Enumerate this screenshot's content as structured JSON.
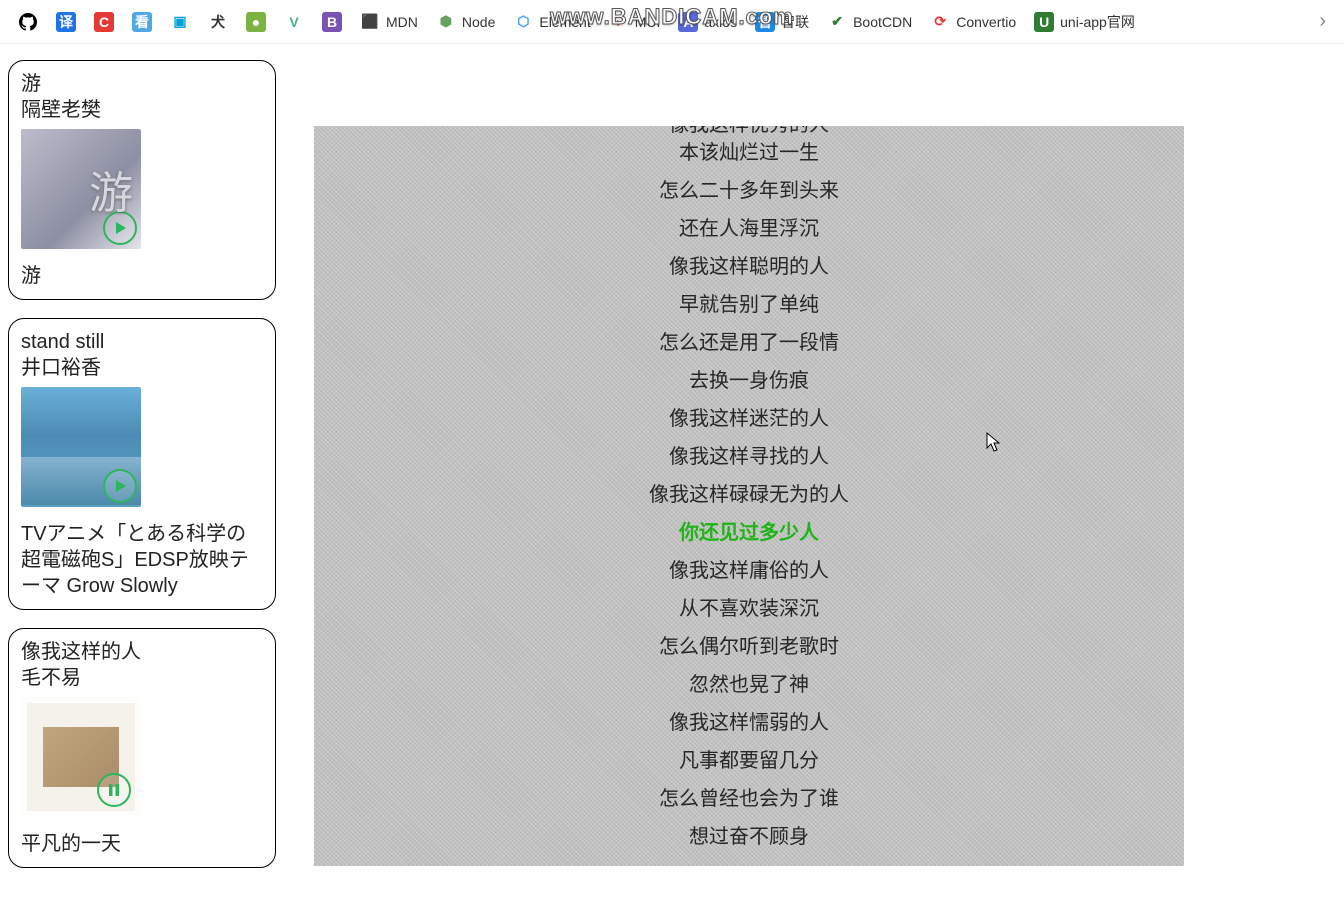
{
  "watermark": "www.BANDICAM.com",
  "bookmarks": [
    {
      "label": "",
      "icon_bg": "#ffffff",
      "icon_fg": "#000000",
      "glyph": "gh"
    },
    {
      "label": "",
      "icon_bg": "#1e73e8",
      "icon_fg": "#ffffff",
      "glyph": "译"
    },
    {
      "label": "",
      "icon_bg": "#e53935",
      "icon_fg": "#ffffff",
      "glyph": "C"
    },
    {
      "label": "",
      "icon_bg": "#4fa8e6",
      "icon_fg": "#ffffff",
      "glyph": "看"
    },
    {
      "label": "",
      "icon_bg": "#ffffff",
      "icon_fg": "#00a1d6",
      "glyph": "▣"
    },
    {
      "label": "",
      "icon_bg": "#ffffff",
      "icon_fg": "#333333",
      "glyph": "犬"
    },
    {
      "label": "",
      "icon_bg": "#7cb342",
      "icon_fg": "#ffffff",
      "glyph": "●"
    },
    {
      "label": "",
      "icon_bg": "#ffffff",
      "icon_fg": "#41b883",
      "glyph": "V"
    },
    {
      "label": "",
      "icon_bg": "#7952b3",
      "icon_fg": "#ffffff",
      "glyph": "B"
    },
    {
      "label": "MDN",
      "icon_bg": "#ffffff",
      "icon_fg": "#000000",
      "glyph": "⬛"
    },
    {
      "label": "Node",
      "icon_bg": "#ffffff",
      "icon_fg": "#68a063",
      "glyph": "⬢"
    },
    {
      "label": "Element",
      "icon_bg": "#ffffff",
      "icon_fg": "#409eff",
      "glyph": "⬡"
    },
    {
      "label": "MUI",
      "icon_bg": "#ffffff",
      "icon_fg": "#ff5722",
      "glyph": "◗"
    },
    {
      "label": "axios",
      "icon_bg": "#5a67d8",
      "icon_fg": "#ffffff",
      "glyph": "A"
    },
    {
      "label": "智联",
      "icon_bg": "#1e88e5",
      "icon_fg": "#ffffff",
      "glyph": "智"
    },
    {
      "label": "BootCDN",
      "icon_bg": "#ffffff",
      "icon_fg": "#2e7d32",
      "glyph": "✔"
    },
    {
      "label": "Convertio",
      "icon_bg": "#ffffff",
      "icon_fg": "#e53935",
      "glyph": "⟳"
    },
    {
      "label": "uni-app官网",
      "icon_bg": "#2e7d32",
      "icon_fg": "#ffffff",
      "glyph": "U"
    }
  ],
  "cards": [
    {
      "title": "游",
      "artist": "隔壁老樊",
      "album": "游",
      "state": "play"
    },
    {
      "title": "stand still",
      "artist": "井口裕香",
      "album": "TVアニメ「とある科学の超電磁砲S」EDSP放映テーマ Grow Slowly",
      "state": "play"
    },
    {
      "title": "像我这样的人",
      "artist": "毛不易",
      "album": "平凡的一天",
      "state": "pause"
    }
  ],
  "lyrics": {
    "active_index": 11,
    "lines": [
      "像我这样优秀的人",
      "本该灿烂过一生",
      "怎么二十多年到头来",
      "还在人海里浮沉",
      "像我这样聪明的人",
      "早就告别了单纯",
      "怎么还是用了一段情",
      "去换一身伤痕",
      "像我这样迷茫的人",
      "像我这样寻找的人",
      "像我这样碌碌无为的人",
      "你还见过多少人",
      "像我这样庸俗的人",
      "从不喜欢装深沉",
      "怎么偶尔听到老歌时",
      "忽然也晃了神",
      "像我这样懦弱的人",
      "凡事都要留几分",
      "怎么曾经也会为了谁",
      "想过奋不顾身"
    ]
  }
}
